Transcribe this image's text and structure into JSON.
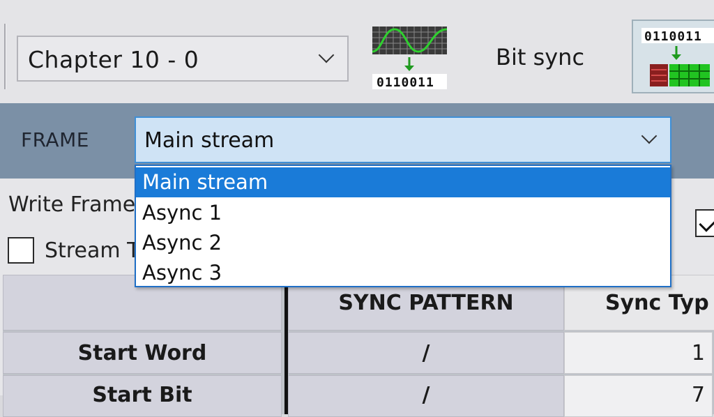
{
  "toolbar": {
    "chapter_select_value": "Chapter 10 - 0",
    "bitsync_label": "Bit sync",
    "bitsync_icon_bits": "0110011",
    "decom_icon_bits": "0110011"
  },
  "frame": {
    "label": "FRAME",
    "selected": "Main stream",
    "options": [
      "Main stream",
      "Async 1",
      "Async 2",
      "Async 3"
    ]
  },
  "content": {
    "write_frame_label": "Write Frame",
    "stream_label": "Stream T",
    "stream_checked": false,
    "right_checked": true
  },
  "table": {
    "columns": [
      "",
      "SYNC PATTERN",
      "Sync Typ"
    ],
    "rows": [
      {
        "label": "Start Word",
        "sync_pattern": "/",
        "sync_type": "1"
      },
      {
        "label": "Start Bit",
        "sync_pattern": "/",
        "sync_type": "7"
      }
    ]
  },
  "colors": {
    "frame_bar": "#7b90a6",
    "selection": "#1a7bd8",
    "select_focus": "#cfe3f5"
  }
}
